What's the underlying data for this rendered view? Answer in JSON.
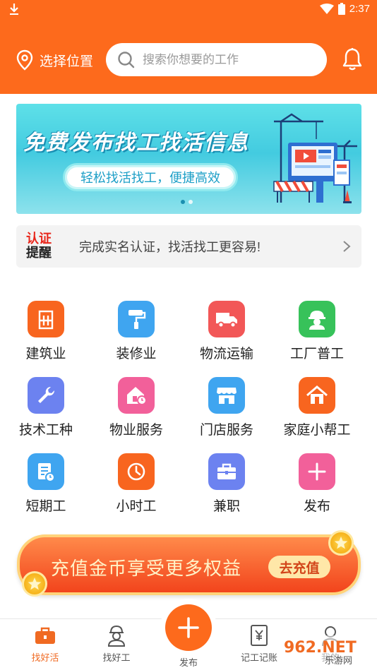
{
  "status_bar": {
    "time": "2:37"
  },
  "header": {
    "location_label": "选择位置",
    "search_placeholder": "搜索你想要的工作"
  },
  "banner": {
    "title": "免费发布找工找活信息",
    "subtitle": "轻松找活找工，便捷高效"
  },
  "verify": {
    "badge_line1": "认证",
    "badge_line2": "提醒",
    "text": "完成实名认证，找活找工更容易!"
  },
  "categories": [
    {
      "label": "建筑业",
      "color": "#f8651f",
      "icon": "building-icon"
    },
    {
      "label": "装修业",
      "color": "#3fa5f0",
      "icon": "paint-roller-icon"
    },
    {
      "label": "物流运输",
      "color": "#f25757",
      "icon": "truck-icon"
    },
    {
      "label": "工厂普工",
      "color": "#37c25a",
      "icon": "hardhat-worker-icon"
    },
    {
      "label": "技术工种",
      "color": "#6c82f0",
      "icon": "wrench-icon"
    },
    {
      "label": "物业服务",
      "color": "#f2609a",
      "icon": "house-clock-icon"
    },
    {
      "label": "门店服务",
      "color": "#3fa5f0",
      "icon": "storefront-icon"
    },
    {
      "label": "家庭小帮工",
      "color": "#f8651f",
      "icon": "home-icon"
    },
    {
      "label": "短期工",
      "color": "#3fa5f0",
      "icon": "calendar-clock-icon"
    },
    {
      "label": "小时工",
      "color": "#f8651f",
      "icon": "clock-icon"
    },
    {
      "label": "兼职",
      "color": "#6c82f0",
      "icon": "briefcase-icon"
    },
    {
      "label": "发布",
      "color": "#f2609a",
      "icon": "plus-icon"
    }
  ],
  "recharge": {
    "text": "充值金币享受更多权益",
    "button": "去充值"
  },
  "tabbar": {
    "items": [
      {
        "label": "找好活",
        "icon": "toolbox-icon"
      },
      {
        "label": "找好工",
        "icon": "worker-icon"
      },
      {
        "label": "发布",
        "icon": "plus-icon"
      },
      {
        "label": "记工记账",
        "icon": "ledger-icon"
      },
      {
        "label": "我的",
        "icon": "profile-icon"
      }
    ]
  },
  "watermark": {
    "text": "962.NET",
    "subtext": "乐游网"
  },
  "colors": {
    "brand": "#fd6a1c",
    "active_tab": "#f06a22"
  }
}
